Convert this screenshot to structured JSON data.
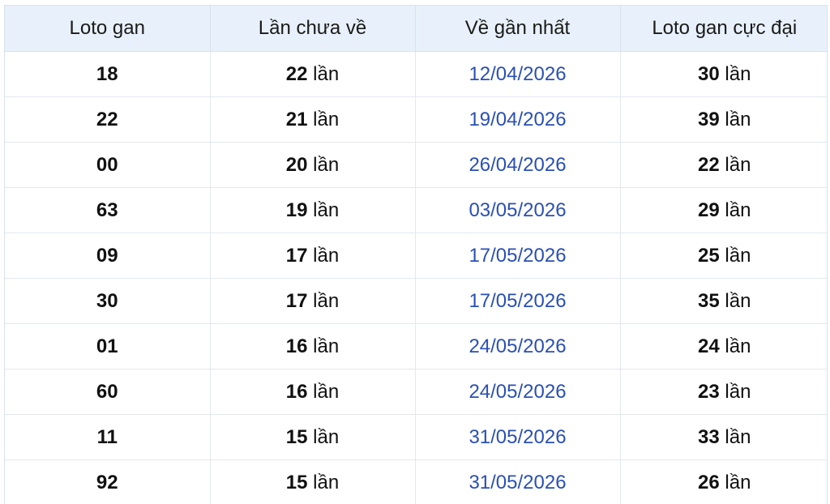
{
  "table": {
    "headers": [
      "Loto gan",
      "Lần chưa về",
      "Về gần nhất",
      "Loto gan cực đại"
    ],
    "unit": "lần",
    "rows": [
      {
        "loto": "18",
        "missed": "22",
        "last": "12/04/2026",
        "max": "30"
      },
      {
        "loto": "22",
        "missed": "21",
        "last": "19/04/2026",
        "max": "39"
      },
      {
        "loto": "00",
        "missed": "20",
        "last": "26/04/2026",
        "max": "22"
      },
      {
        "loto": "63",
        "missed": "19",
        "last": "03/05/2026",
        "max": "29"
      },
      {
        "loto": "09",
        "missed": "17",
        "last": "17/05/2026",
        "max": "25"
      },
      {
        "loto": "30",
        "missed": "17",
        "last": "17/05/2026",
        "max": "35"
      },
      {
        "loto": "01",
        "missed": "16",
        "last": "24/05/2026",
        "max": "24"
      },
      {
        "loto": "60",
        "missed": "16",
        "last": "24/05/2026",
        "max": "23"
      },
      {
        "loto": "11",
        "missed": "15",
        "last": "31/05/2026",
        "max": "33"
      },
      {
        "loto": "92",
        "missed": "15",
        "last": "31/05/2026",
        "max": "26"
      }
    ]
  },
  "colors": {
    "header_bg": "#e8f1fb",
    "date_text": "#2a4fb5",
    "grid": "#e3e8ef"
  }
}
